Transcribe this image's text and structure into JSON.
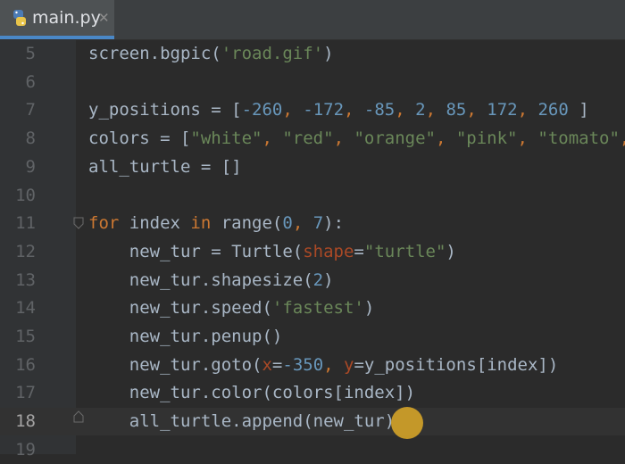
{
  "tab": {
    "filename": "main.py",
    "close": "✕"
  },
  "lines": [
    {
      "num": "5",
      "segments": [
        [
          "fn",
          "screen.bgpic("
        ],
        [
          "str",
          "'road.gif'"
        ],
        [
          "fn",
          ")"
        ]
      ]
    },
    {
      "num": "6",
      "segments": []
    },
    {
      "num": "7",
      "segments": [
        [
          "fn",
          "y_positions = ["
        ],
        [
          "num",
          "-260"
        ],
        [
          "kw",
          ", "
        ],
        [
          "num",
          "-172"
        ],
        [
          "kw",
          ", "
        ],
        [
          "num",
          "-85"
        ],
        [
          "kw",
          ", "
        ],
        [
          "num",
          "2"
        ],
        [
          "kw",
          ", "
        ],
        [
          "num",
          "85"
        ],
        [
          "kw",
          ", "
        ],
        [
          "num",
          "172"
        ],
        [
          "kw",
          ", "
        ],
        [
          "num",
          "260"
        ],
        [
          "fn",
          " ]"
        ]
      ]
    },
    {
      "num": "8",
      "segments": [
        [
          "fn",
          "colors = ["
        ],
        [
          "str",
          "\"white\""
        ],
        [
          "kw",
          ", "
        ],
        [
          "str",
          "\"red\""
        ],
        [
          "kw",
          ", "
        ],
        [
          "str",
          "\"orange\""
        ],
        [
          "kw",
          ", "
        ],
        [
          "str",
          "\"pink\""
        ],
        [
          "kw",
          ", "
        ],
        [
          "str",
          "\"tomato\""
        ],
        [
          "kw",
          ","
        ]
      ]
    },
    {
      "num": "9",
      "segments": [
        [
          "fn",
          "all_turtle = []"
        ]
      ]
    },
    {
      "num": "10",
      "segments": []
    },
    {
      "num": "11",
      "segments": [
        [
          "kw",
          "for "
        ],
        [
          "fn",
          "index "
        ],
        [
          "kw",
          "in "
        ],
        [
          "fn",
          "range("
        ],
        [
          "num",
          "0"
        ],
        [
          "kw",
          ", "
        ],
        [
          "num",
          "7"
        ],
        [
          "fn",
          "):"
        ]
      ]
    },
    {
      "num": "12",
      "segments": [
        [
          "fn",
          "    new_tur = Turtle("
        ],
        [
          "param",
          "shape"
        ],
        [
          "fn",
          "="
        ],
        [
          "str",
          "\"turtle\""
        ],
        [
          "fn",
          ")"
        ]
      ]
    },
    {
      "num": "13",
      "segments": [
        [
          "fn",
          "    new_tur.shapesize("
        ],
        [
          "num",
          "2"
        ],
        [
          "fn",
          ")"
        ]
      ]
    },
    {
      "num": "14",
      "segments": [
        [
          "fn",
          "    new_tur.speed("
        ],
        [
          "str",
          "'fastest'"
        ],
        [
          "fn",
          ")"
        ]
      ]
    },
    {
      "num": "15",
      "segments": [
        [
          "fn",
          "    new_tur.penup()"
        ]
      ]
    },
    {
      "num": "16",
      "segments": [
        [
          "fn",
          "    new_tur.goto("
        ],
        [
          "param",
          "x"
        ],
        [
          "fn",
          "="
        ],
        [
          "num",
          "-350"
        ],
        [
          "kw",
          ", "
        ],
        [
          "param",
          "y"
        ],
        [
          "fn",
          "=y_positions[index])"
        ]
      ]
    },
    {
      "num": "17",
      "segments": [
        [
          "fn",
          "    new_tur.color(colors[index])"
        ]
      ]
    },
    {
      "num": "18",
      "segments": [
        [
          "fn",
          "    all_turtle.append(new_tur)"
        ]
      ],
      "current": true
    },
    {
      "num": "19",
      "segments": []
    }
  ],
  "icons": {
    "tab_icon": "python-file-icon",
    "fold_open": "fold-open-icon",
    "fold_end": "fold-end-icon"
  },
  "colors": {
    "accent": "#4a88c7",
    "cursor_highlight": "#deaa28"
  }
}
